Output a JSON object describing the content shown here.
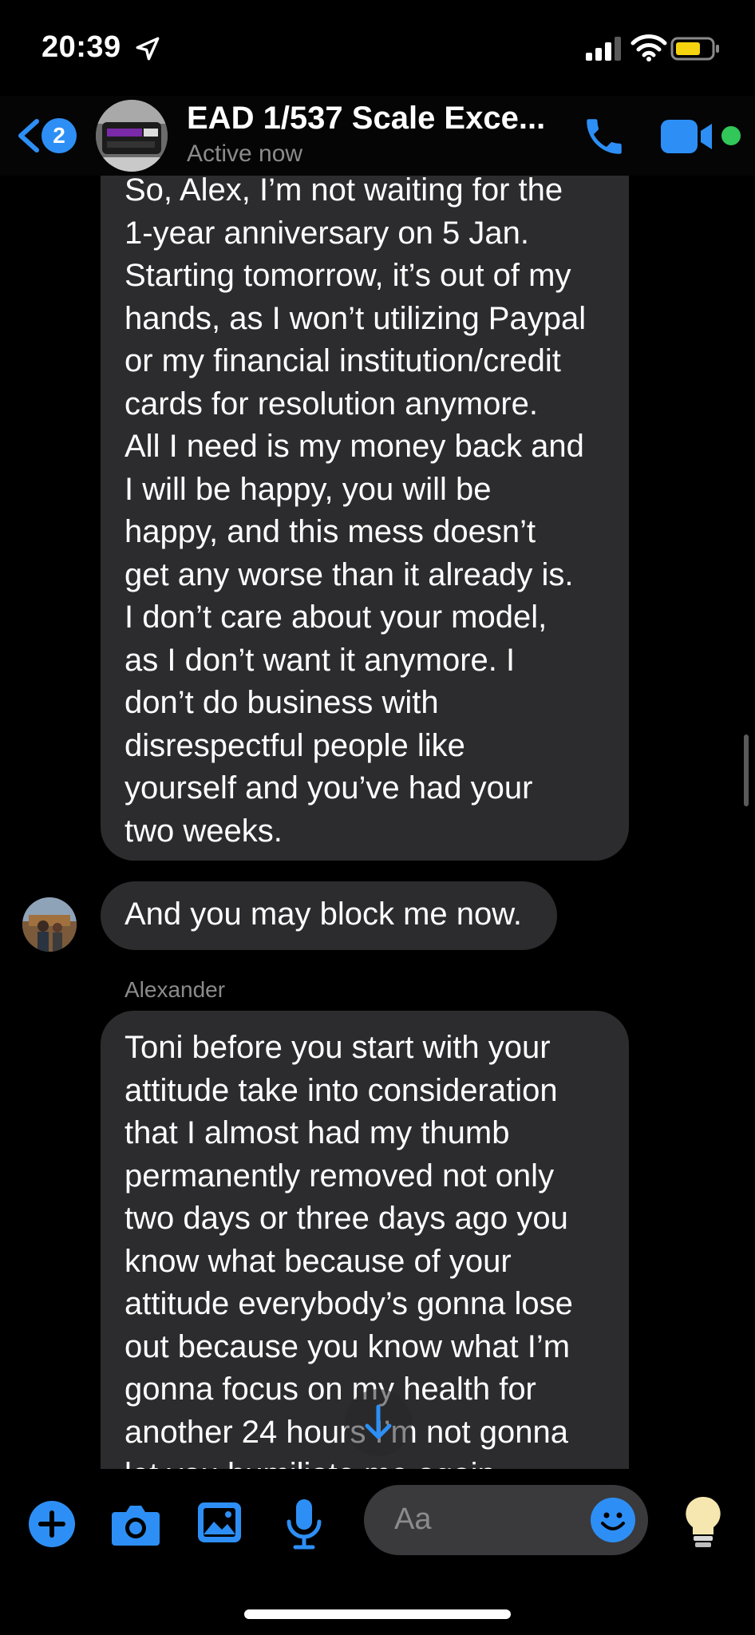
{
  "status_bar": {
    "time": "20:39"
  },
  "header": {
    "back_badge": "2",
    "title": "EAD 1/537  Scale Exce...",
    "subtitle": "Active now"
  },
  "messages": [
    {
      "lines": [
        "So, Alex, I’m not waiting for the",
        "1-year anniversary on 5 Jan.",
        "Starting tomorrow, it’s out of my",
        "hands, as I won’t utilizing Paypal",
        "or my financial institution/credit",
        "cards for resolution anymore.",
        "All I need is my money back and",
        "I will be happy, you will be",
        "happy, and this mess doesn’t",
        "get any worse than it already is.",
        "I don’t care about your model,",
        "as I don’t want it anymore.  I",
        "don’t do business with",
        "disrespectful people like",
        "yourself and you’ve had your",
        "two weeks."
      ]
    },
    {
      "lines": [
        "And you may block me now."
      ]
    },
    {
      "sender": "Alexander",
      "lines": [
        "Toni before you start with your",
        "attitude take into consideration",
        "that I almost had my thumb",
        "permanently removed not only",
        "two days or three days ago you",
        "know what because of your",
        "attitude everybody’s gonna lose",
        "out because you know what I’m",
        "gonna focus on my health for",
        "another 24 hours I’m not gonna",
        "let you humiliate me again"
      ]
    }
  ],
  "composer": {
    "placeholder": "Aa"
  },
  "colors": {
    "accent": "#2d8ff5",
    "bubble": "#2c2c2e",
    "online": "#31c759"
  }
}
